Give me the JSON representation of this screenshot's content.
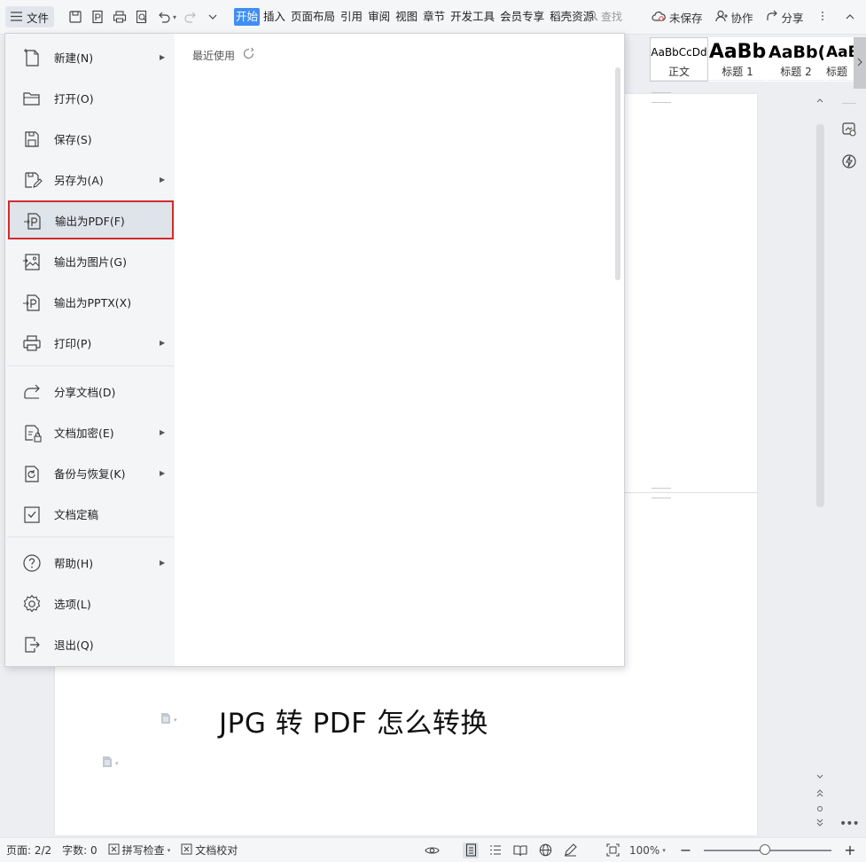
{
  "toolbar": {
    "file_label": "文件",
    "tabs": [
      "开始",
      "插入",
      "页面布局",
      "引用",
      "审阅",
      "视图",
      "章节",
      "开发工具",
      "会员专享",
      "稻壳资源"
    ],
    "search_label": "查找",
    "unsaved_label": "未保存",
    "collab_label": "协作",
    "share_label": "分享"
  },
  "styles": [
    {
      "preview": "AaBbCcDd",
      "label": "正文"
    },
    {
      "preview": "AaBb",
      "label": "标题 1"
    },
    {
      "preview": "AaBb(",
      "label": "标题 2"
    },
    {
      "preview": "AaB",
      "label": "标题"
    }
  ],
  "file_menu": {
    "items": [
      {
        "label": "新建(N)",
        "icon": "new-doc-icon",
        "submenu": true
      },
      {
        "label": "打开(O)",
        "icon": "folder-open-icon",
        "submenu": false
      },
      {
        "label": "保存(S)",
        "icon": "save-icon",
        "submenu": false
      },
      {
        "label": "另存为(A)",
        "icon": "save-as-icon",
        "submenu": true
      },
      {
        "label": "输出为PDF(F)",
        "icon": "export-pdf-icon",
        "submenu": false,
        "selected": true
      },
      {
        "label": "输出为图片(G)",
        "icon": "export-image-icon",
        "submenu": false
      },
      {
        "label": "输出为PPTX(X)",
        "icon": "export-pptx-icon",
        "submenu": false
      },
      {
        "label": "打印(P)",
        "icon": "print-icon",
        "submenu": true
      },
      {
        "label": "分享文档(D)",
        "icon": "share-doc-icon",
        "submenu": false
      },
      {
        "label": "文档加密(E)",
        "icon": "encrypt-icon",
        "submenu": true
      },
      {
        "label": "备份与恢复(K)",
        "icon": "backup-icon",
        "submenu": true
      },
      {
        "label": "文档定稿",
        "icon": "finalize-icon",
        "submenu": false
      },
      {
        "label": "帮助(H)",
        "icon": "help-icon",
        "submenu": true
      },
      {
        "label": "选项(L)",
        "icon": "settings-icon",
        "submenu": false
      },
      {
        "label": "退出(Q)",
        "icon": "exit-icon",
        "submenu": false
      }
    ],
    "recent_label": "最近使用"
  },
  "document": {
    "heading": "JPG 转 PDF 怎么转换"
  },
  "statusbar": {
    "page": "页面: 2/2",
    "wordcount": "字数: 0",
    "spellcheck": "拼写检查",
    "proofread": "文档校对",
    "zoom": "100%",
    "zoom_level": 1.0
  },
  "colors": {
    "accent": "#3f8ef2",
    "selected_outline": "#d52b2b"
  }
}
